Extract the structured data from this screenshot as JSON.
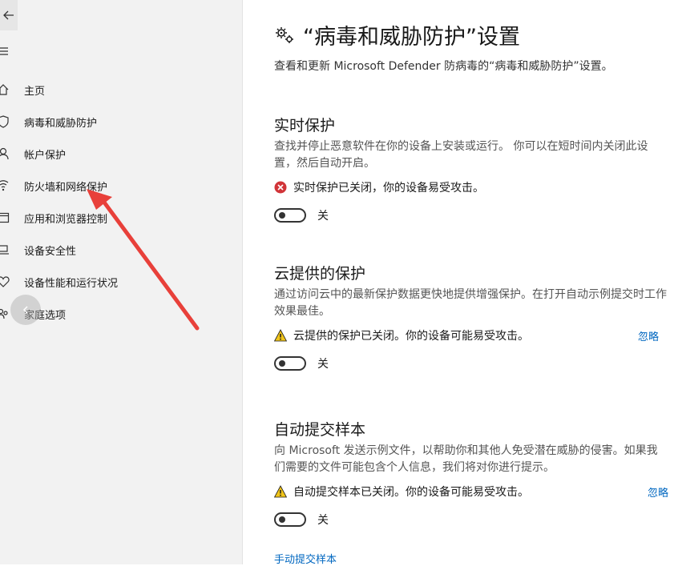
{
  "sidebar": {
    "items": [
      {
        "label": "主页",
        "icon": "home-icon"
      },
      {
        "label": "病毒和威胁防护",
        "icon": "shield-icon"
      },
      {
        "label": "帐户保护",
        "icon": "person-icon"
      },
      {
        "label": "防火墙和网络保护",
        "icon": "wifi-icon"
      },
      {
        "label": "应用和浏览器控制",
        "icon": "browser-window-icon"
      },
      {
        "label": "设备安全性",
        "icon": "laptop-icon"
      },
      {
        "label": "设备性能和运行状况",
        "icon": "heart-icon"
      },
      {
        "label": "家庭选项",
        "icon": "family-icon"
      }
    ]
  },
  "main": {
    "title": "“病毒和威胁防护”设置",
    "subtitle": "查看和更新 Microsoft Defender 防病毒的“病毒和威胁防护”设置。",
    "sections": [
      {
        "heading": "实时保护",
        "description": "查找并停止恶意软件在你的设备上安装或运行。 你可以在短时间内关闭此设置，然后自动开启。",
        "status": "实时保护已关闭，你的设备易受攻击。",
        "status_type": "error",
        "dismiss": "",
        "toggle_label": "关"
      },
      {
        "heading": "云提供的保护",
        "description": "通过访问云中的最新保护数据更快地提供增强保护。在打开自动示例提交时工作效果最佳。",
        "status": "云提供的保护已关闭。你的设备可能易受攻击。",
        "status_type": "warning",
        "dismiss": "忽略",
        "toggle_label": "关"
      },
      {
        "heading": "自动提交样本",
        "description": "向 Microsoft 发送示例文件，以帮助你和其他人免受潜在威胁的侵害。如果我们需要的文件可能包含个人信息，我们将对你进行提示。",
        "status": "自动提交样本已关闭。你的设备可能易受攻击。",
        "status_type": "warning",
        "dismiss": "忽略",
        "toggle_label": "关"
      }
    ],
    "manual_submit_link": "手动提交样本"
  },
  "colors": {
    "accent": "#0067c0",
    "error": "#d13438",
    "warning": "#f0c419",
    "annotation_arrow": "#e8403a"
  }
}
